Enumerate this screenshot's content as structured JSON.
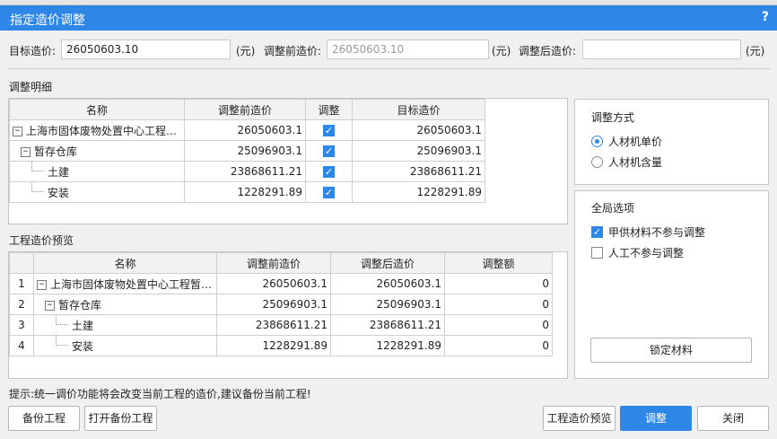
{
  "window": {
    "title": "指定造价调整",
    "help_icon": "?"
  },
  "target": {
    "target_label": "目标造价:",
    "target_value": "26050603.10",
    "unit1": "(元)",
    "before_label": "调整前造价:",
    "before_value": "26050603.10",
    "unit2": "(元)",
    "after_label": "调整后造价:",
    "after_value": "",
    "unit3": "(元)"
  },
  "detail": {
    "title": "调整明细",
    "columns": [
      "名称",
      "调整前造价",
      "调整",
      "目标造价"
    ],
    "rows": [
      {
        "name": "上海市固体废物处置中心工程…",
        "before": "26050603.1",
        "adjust": true,
        "target": "26050603.1"
      },
      {
        "name": "暂存仓库",
        "before": "25096903.1",
        "adjust": true,
        "target": "25096903.1"
      },
      {
        "name": "土建",
        "before": "23868611.21",
        "adjust": true,
        "target": "23868611.21"
      },
      {
        "name": "安装",
        "before": "1228291.89",
        "adjust": true,
        "target": "1228291.89"
      }
    ]
  },
  "preview": {
    "title": "工程造价预览",
    "columns": [
      "",
      "名称",
      "调整前造价",
      "调整后造价",
      "调整额"
    ],
    "rows": [
      {
        "idx": "1",
        "name": "上海市固体废物处置中心工程暂…",
        "before": "26050603.1",
        "after": "26050603.1",
        "delta": "0"
      },
      {
        "idx": "2",
        "name": "暂存仓库",
        "before": "25096903.1",
        "after": "25096903.1",
        "delta": "0"
      },
      {
        "idx": "3",
        "name": "土建",
        "before": "23868611.21",
        "after": "23868611.21",
        "delta": "0"
      },
      {
        "idx": "4",
        "name": "安装",
        "before": "1228291.89",
        "after": "1228291.89",
        "delta": "0"
      }
    ]
  },
  "method": {
    "title": "调整方式",
    "options": [
      {
        "label": "人材机单价",
        "selected": true
      },
      {
        "label": "人材机含量",
        "selected": false
      }
    ]
  },
  "global": {
    "title": "全局选项",
    "options": [
      {
        "label": "甲供材料不参与调整",
        "checked": true
      },
      {
        "label": "人工不参与调整",
        "checked": false
      }
    ],
    "lock_button": "锁定材料"
  },
  "hint": "提示:统一调价功能将会改变当前工程的造价,建议备份当前工程!",
  "buttons": {
    "backup": "备份工程",
    "open_backup": "打开备份工程",
    "preview": "工程造价预览",
    "adjust": "调整",
    "close": "关闭"
  },
  "colors": {
    "accent": "#2e86e6"
  }
}
